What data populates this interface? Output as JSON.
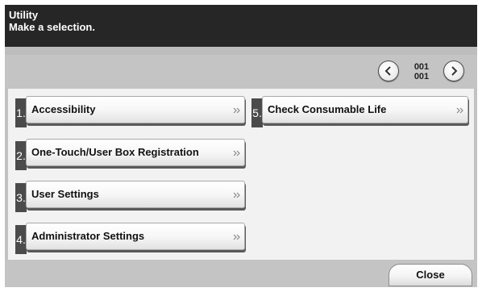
{
  "header": {
    "title": "Utility",
    "subtitle": "Make a selection."
  },
  "pager": {
    "current_page": "001",
    "total_pages": "001"
  },
  "menu": {
    "items": [
      {
        "number": "1.",
        "label": "Accessibility"
      },
      {
        "number": "2.",
        "label": "One-Touch/User Box Registration"
      },
      {
        "number": "3.",
        "label": "User Settings"
      },
      {
        "number": "4.",
        "label": "Administrator Settings"
      },
      {
        "number": "5.",
        "label": "Check Consumable Life"
      }
    ]
  },
  "footer": {
    "close_label": "Close"
  },
  "icons": {
    "prev": "chevron-left-icon",
    "next": "chevron-right-icon",
    "item_arrow": "double-chevron-right-icon"
  },
  "colors": {
    "header_bg": "#262626",
    "screen_bg": "#c2c2c2",
    "content_bg": "#f2f2f2",
    "number_tab": "#4b4b4b"
  }
}
